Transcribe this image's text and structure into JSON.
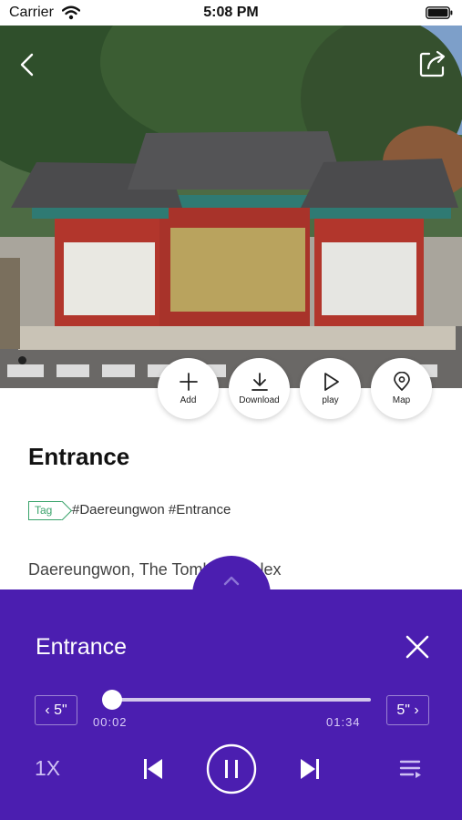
{
  "status_bar": {
    "carrier": "Carrier",
    "time": "5:08 PM"
  },
  "hero": {
    "image_alt": "Daereungwon entrance gate"
  },
  "actions": [
    {
      "label": "Add",
      "icon": "plus-icon"
    },
    {
      "label": "Download",
      "icon": "download-icon"
    },
    {
      "label": "play",
      "icon": "play-icon"
    },
    {
      "label": "Map",
      "icon": "map-pin-icon"
    }
  ],
  "place": {
    "title": "Entrance",
    "tag_label": "Tag",
    "hashtags": "#Daereungwon #Entrance",
    "description": "Daereungwon, The Tomb Complex"
  },
  "player": {
    "track_title": "Entrance",
    "skip_back_label": "‹ 5\"",
    "skip_forward_label": "5\" ›",
    "elapsed": "00:02",
    "total": "01:34",
    "progress": 0.02,
    "speed": "1X"
  },
  "colors": {
    "player_bg": "#4b1eb0",
    "tag_green": "#3aa36b"
  }
}
